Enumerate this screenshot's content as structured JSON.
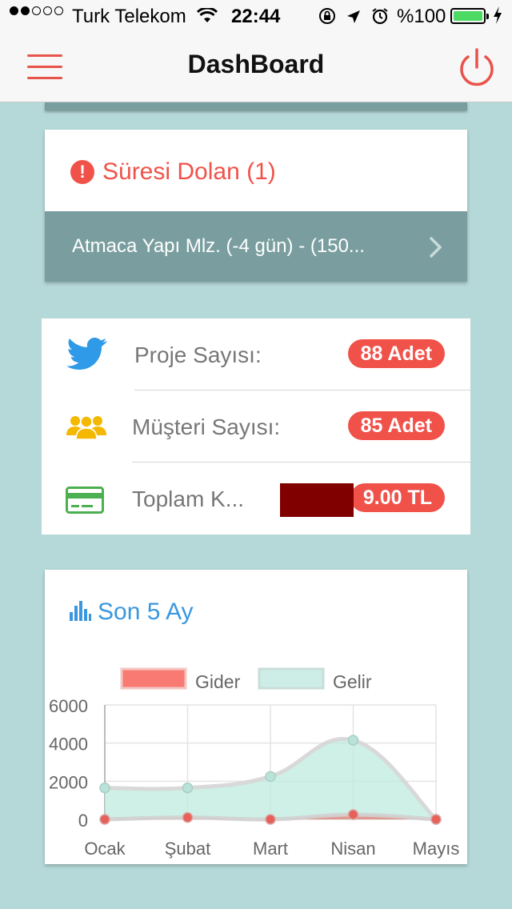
{
  "status_bar": {
    "carrier": "Turk Telekom",
    "time": "22:44",
    "battery_percent": "%100",
    "signal_bars_filled": 2,
    "signal_bars_total": 5,
    "icons": [
      "wifi-icon",
      "rotation-lock-icon",
      "location-arrow-icon",
      "alarm-icon",
      "battery-icon",
      "charging-bolt-icon"
    ]
  },
  "navbar": {
    "title": "DashBoard",
    "menu_icon": "hamburger-menu-icon",
    "power_icon": "power-icon"
  },
  "expired": {
    "title": "Süresi Dolan (1)",
    "icon": "alert-icon",
    "items": [
      {
        "text": "Atmaca Yapı Mlz. (-4 gün) - (150..."
      }
    ]
  },
  "stats": [
    {
      "icon": "twitter-bird-icon",
      "label": "Proje Sayısı:",
      "value": "88 Adet"
    },
    {
      "icon": "users-group-icon",
      "label": "Müşteri Sayısı:",
      "value": "85 Adet"
    },
    {
      "icon": "credit-card-icon",
      "label": "Toplam K...",
      "value": "9.00 TL"
    }
  ],
  "chart_card": {
    "title": "Son 5 Ay",
    "icon": "bar-chart-icon"
  },
  "chart_data": {
    "type": "area",
    "categories": [
      "Ocak",
      "Şubat",
      "Mart",
      "Nisan",
      "Mayıs"
    ],
    "ylim": [
      0,
      6000
    ],
    "yticks": [
      0,
      2000,
      4000,
      6000
    ],
    "legend_position": "top",
    "grid": true,
    "series": [
      {
        "name": "Gider",
        "values": [
          0,
          100,
          0,
          250,
          0
        ],
        "color": "#f0524a"
      },
      {
        "name": "Gelir",
        "values": [
          1650,
          1650,
          2250,
          4150,
          0
        ],
        "color": "#c8ece3"
      }
    ]
  },
  "colors": {
    "accent": "#f0524a",
    "background": "#b5d8d8",
    "row_bg": "#7a9e9f",
    "chart_title": "#3a97dd"
  }
}
